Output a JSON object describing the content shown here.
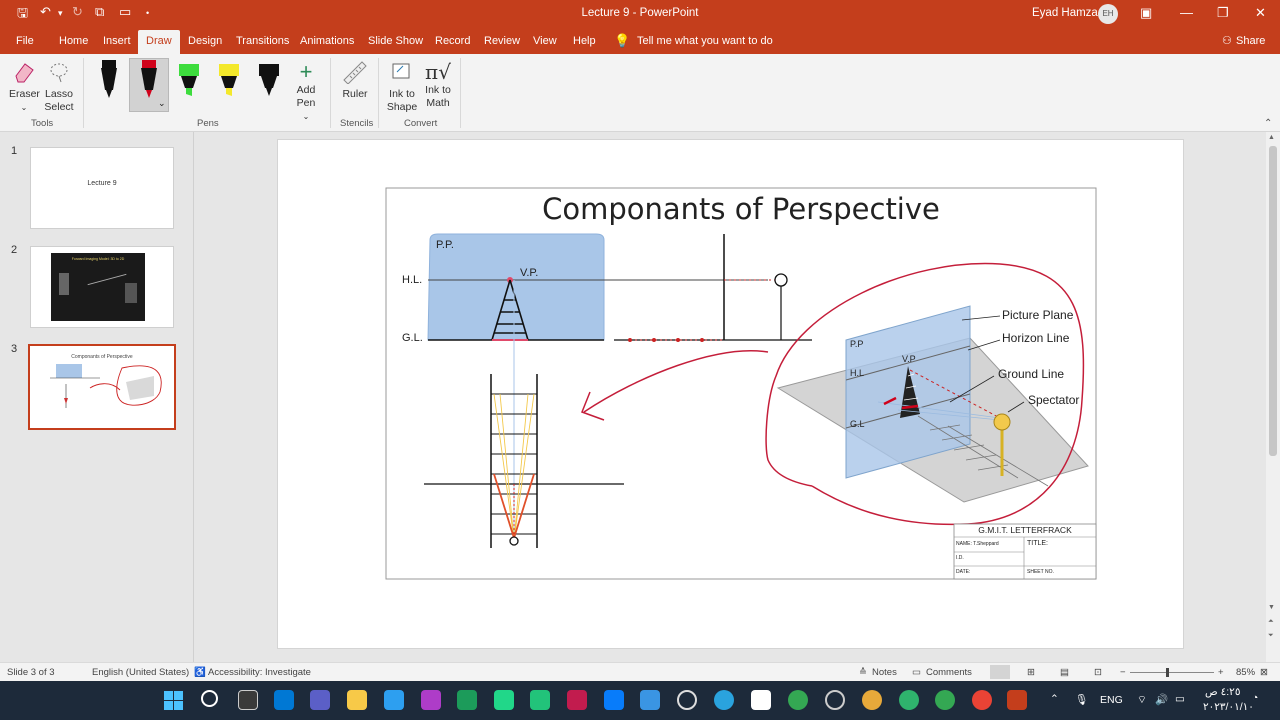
{
  "window": {
    "title": "Lecture 9  -  PowerPoint",
    "user": "Eyad Hamza",
    "avatar_initials": "EH"
  },
  "tabs": [
    "File",
    "Home",
    "Insert",
    "Draw",
    "Design",
    "Transitions",
    "Animations",
    "Slide Show",
    "Record",
    "Review",
    "View",
    "Help"
  ],
  "active_tab": "Draw",
  "tell_me": "Tell me what you want to do",
  "share": "Share",
  "ribbon": {
    "tools": {
      "eraser": "Eraser",
      "lasso": "Lasso Select",
      "group": "Tools"
    },
    "pens": {
      "add_pen": "Add Pen",
      "group": "Pens",
      "colors": [
        "#111111",
        "#d0021b",
        "#3ddc3d",
        "#f3e82b",
        "#111111"
      ]
    },
    "stencils": {
      "ruler": "Ruler",
      "group": "Stencils"
    },
    "convert": {
      "ink_to_shape": "Ink to Shape",
      "ink_to_math": "Ink to Math",
      "group": "Convert"
    }
  },
  "slides": [
    {
      "num": "1",
      "title": "Lecture 9"
    },
    {
      "num": "2",
      "title": "Forward Imaging Model: 3D to 2D"
    },
    {
      "num": "3",
      "title": "Componants of Perspective"
    }
  ],
  "slide_content": {
    "title": "Componants of Perspective",
    "labels": {
      "pp": "P.P.",
      "hl": "H.L.",
      "gl": "G.L.",
      "vp": "V.P.",
      "picture_plane": "Picture Plane",
      "horizon_line": "Horizon Line",
      "ground_line": "Ground Line",
      "spectator": "Spectator",
      "pp_small": "P.P",
      "hl_small": "H.L",
      "gl_small": "G.L",
      "vp_small": "V.P"
    },
    "title_block": {
      "school": "G.M.I.T. LETTERFRACK",
      "name": "NAME: T.Sheppard",
      "title": "TITLE:",
      "id": "I.D.",
      "date": "DATE:",
      "sheet": "SHEET NO."
    }
  },
  "status": {
    "slide_of": "Slide 3 of 3",
    "language": "English (United States)",
    "accessibility": "Accessibility: Investigate",
    "notes": "Notes",
    "comments": "Comments",
    "zoom": "85%"
  },
  "taskbar": {
    "lang": "ENG",
    "time": "٤:٢٥ ص",
    "date": "٢٠٢٣/٠١/١٠"
  }
}
